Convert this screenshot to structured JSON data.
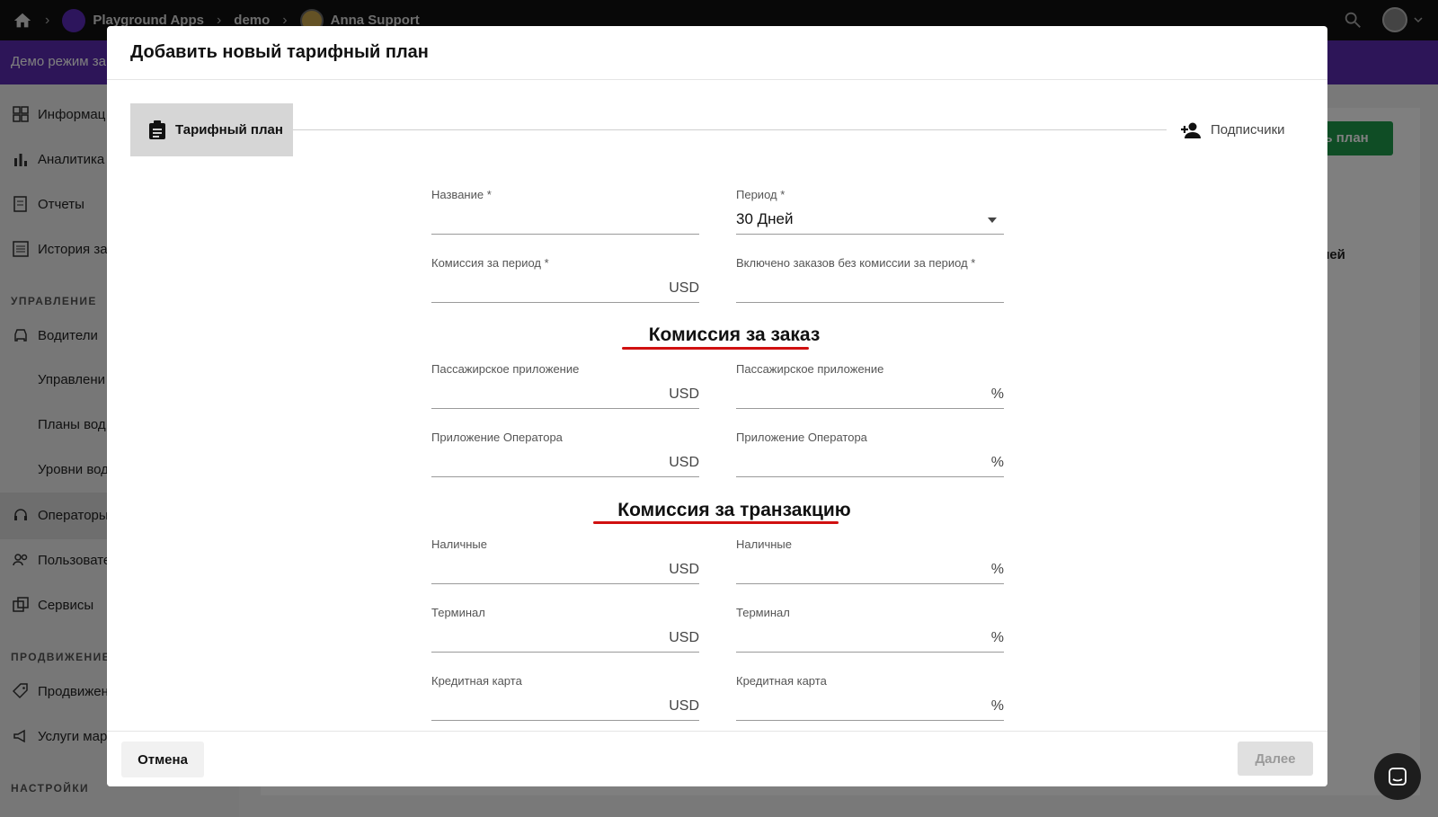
{
  "topbar": {
    "breadcrumbs": [
      "Playground Apps",
      "demo",
      "Anna Support"
    ]
  },
  "demo_bar": {
    "text": "Демо режим за"
  },
  "sidebar": {
    "items": [
      {
        "label": "Информац",
        "icon": "dashboard-icon"
      },
      {
        "label": "Аналитика",
        "icon": "bar-chart-icon"
      },
      {
        "label": "Отчеты",
        "icon": "report-icon"
      },
      {
        "label": "История за",
        "icon": "list-icon"
      }
    ],
    "section_manage": "УПРАВЛЕНИЕ",
    "manage_items": [
      {
        "label": "Водители",
        "icon": "car-icon"
      }
    ],
    "sub_items": [
      "Управлени",
      "Планы вод",
      "Уровни вод"
    ],
    "more_items": [
      {
        "label": "Операторы",
        "icon": "headset-icon"
      },
      {
        "label": "Пользовате",
        "icon": "people-icon"
      },
      {
        "label": "Сервисы",
        "icon": "services-icon"
      }
    ],
    "section_promo": "ПРОДВИЖЕНИЕ",
    "promo_items": [
      {
        "label": "Продвижен",
        "icon": "tag-icon"
      },
      {
        "label": "Услуги мар",
        "icon": "megaphone-icon"
      }
    ],
    "section_settings": "НАСТРОЙКИ"
  },
  "background": {
    "green_button": "ть план",
    "column_fragment": "лей"
  },
  "modal": {
    "title": "Добавить новый тарифный план",
    "steps": [
      {
        "label": "Тарифный план",
        "icon": "clipboard-icon"
      },
      {
        "label": "Подписчики",
        "icon": "person-add-icon"
      }
    ],
    "fields": {
      "name": {
        "label": "Название *",
        "value": ""
      },
      "period": {
        "label": "Период *",
        "value": "30 Дней"
      },
      "period_fee": {
        "label": "Комиссия за период *",
        "suffix": "USD"
      },
      "free_orders": {
        "label": "Включено заказов без комиссии за период *"
      }
    },
    "section_order": "Комиссия за заказ",
    "order_fields": {
      "passenger_usd": {
        "label": "Пассажирское приложение",
        "suffix": "USD"
      },
      "passenger_pct": {
        "label": "Пассажирское приложение",
        "suffix": "%"
      },
      "operator_usd": {
        "label": "Приложение Оператора",
        "suffix": "USD"
      },
      "operator_pct": {
        "label": "Приложение Оператора",
        "suffix": "%"
      }
    },
    "section_transaction": "Комиссия за транзакцию",
    "transaction_fields": {
      "cash_usd": {
        "label": "Наличные",
        "suffix": "USD"
      },
      "cash_pct": {
        "label": "Наличные",
        "suffix": "%"
      },
      "terminal_usd": {
        "label": "Терминал",
        "suffix": "USD"
      },
      "terminal_pct": {
        "label": "Терминал",
        "suffix": "%"
      },
      "card_usd": {
        "label": "Кредитная карта",
        "suffix": "USD"
      },
      "card_pct": {
        "label": "Кредитная карта",
        "suffix": "%"
      }
    },
    "footer": {
      "cancel": "Отмена",
      "next": "Далее"
    }
  },
  "colors": {
    "accent_purple": "#5a2bb0",
    "green": "#1f9a4a",
    "underline_red": "#d01010"
  }
}
